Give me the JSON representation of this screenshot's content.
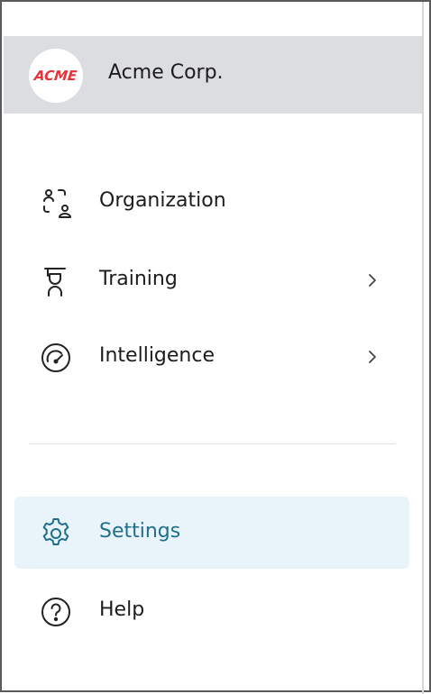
{
  "org": {
    "logo_text": "ACME",
    "name": "Acme Corp."
  },
  "nav": {
    "items": [
      {
        "label": "Organization",
        "icon": "organization-icon",
        "has_submenu": false
      },
      {
        "label": "Training",
        "icon": "training-icon",
        "has_submenu": true
      },
      {
        "label": "Intelligence",
        "icon": "gauge-icon",
        "has_submenu": true
      }
    ],
    "footer_items": [
      {
        "label": "Settings",
        "icon": "gear-icon",
        "active": true
      },
      {
        "label": "Help",
        "icon": "help-icon",
        "active": false
      }
    ]
  },
  "colors": {
    "header_bg": "#dcdde0",
    "active_bg": "#e9f4fa",
    "active_text": "#1f6f8a",
    "logo_red": "#e8323a"
  }
}
